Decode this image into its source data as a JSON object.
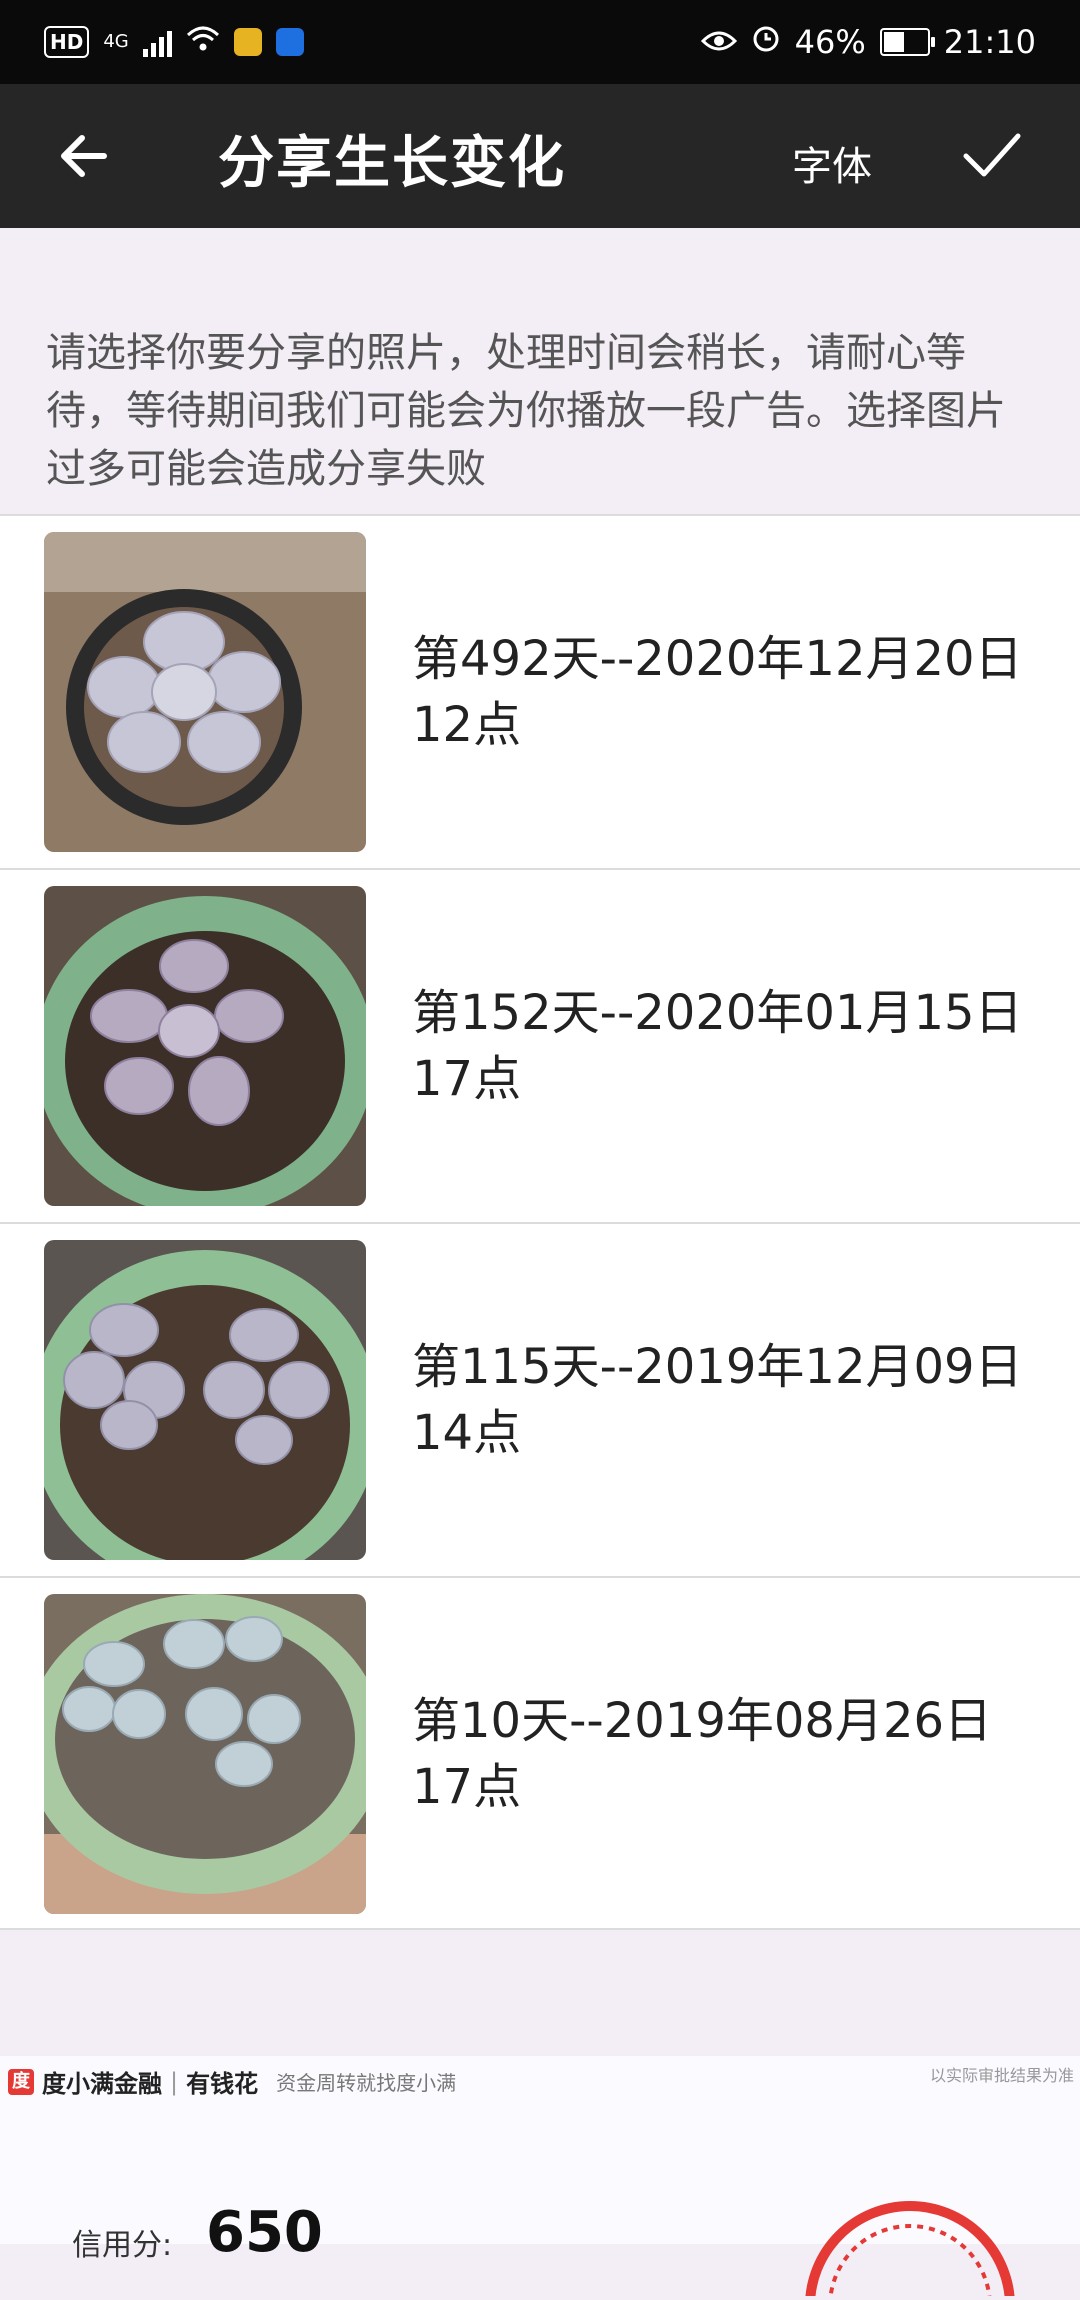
{
  "status_bar": {
    "hd": "HD",
    "network": "4G",
    "battery": "46%",
    "time": "21:10"
  },
  "app_bar": {
    "title": "分享生长变化",
    "font_label": "字体"
  },
  "notice": "请选择你要分享的照片，处理时间会稍长，请耐心等待，等待期间我们可能会为你播放一段广告。选择图片过多可能会造成分享失败",
  "entries": [
    {
      "caption": "第492天--2020年12月20日12点"
    },
    {
      "caption": "第152天--2020年01月15日17点"
    },
    {
      "caption": "第115天--2019年12月09日14点"
    },
    {
      "caption": "第10天--2019年08月26日17点"
    }
  ],
  "ad": {
    "logo_char": "度",
    "brand": "度小满金融",
    "product": "有钱花",
    "tagline": "资金周转就找度小满",
    "note": "以实际审批结果为准",
    "score_label": "信用分:",
    "score": "650"
  },
  "colors": {
    "status_bar": "#0a0a0a",
    "app_bar": "#262626",
    "page_bg": "#f3eef6",
    "ad_red": "#e53935"
  }
}
